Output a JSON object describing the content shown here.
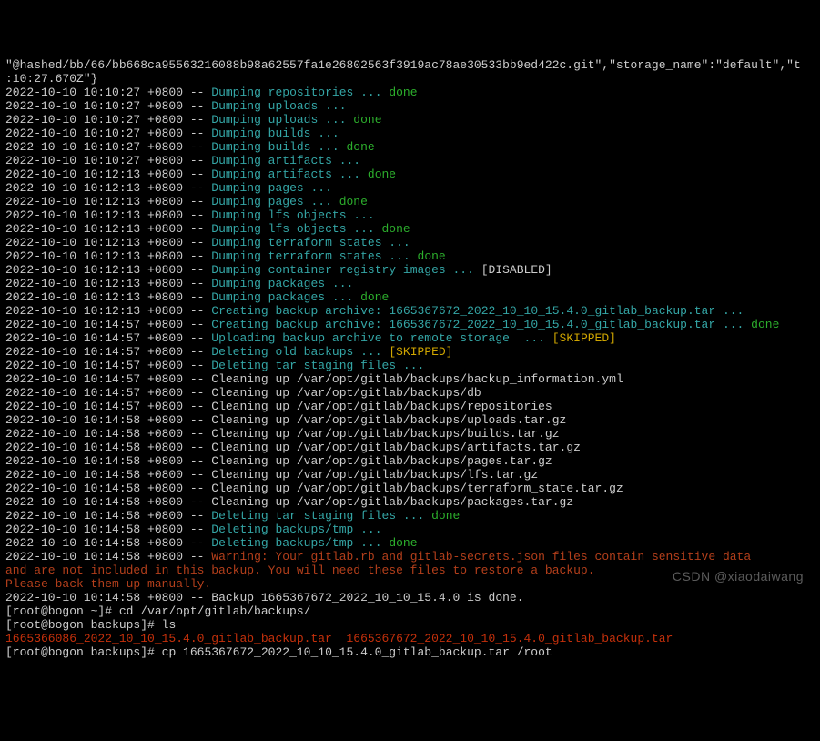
{
  "header": "\"@hashed/bb/66/bb668ca95563216088b98a62557fa1e26802563f3919ac78ae30533bb9ed422c.git\",\"storage_name\":\"default\",\"t",
  "header2": ":10:27.670Z\"}",
  "lines": [
    {
      "ts": "2022-10-10 10:10:27 +0800",
      "sep": " -- ",
      "parts": [
        {
          "cls": "teal",
          "t": "Dumping repositories ... "
        },
        {
          "cls": "green",
          "t": "done"
        }
      ]
    },
    {
      "ts": "2022-10-10 10:10:27 +0800",
      "sep": " -- ",
      "parts": [
        {
          "cls": "teal",
          "t": "Dumping uploads ... "
        }
      ]
    },
    {
      "ts": "2022-10-10 10:10:27 +0800",
      "sep": " -- ",
      "parts": [
        {
          "cls": "teal",
          "t": "Dumping uploads ... "
        },
        {
          "cls": "green",
          "t": "done"
        }
      ]
    },
    {
      "ts": "2022-10-10 10:10:27 +0800",
      "sep": " -- ",
      "parts": [
        {
          "cls": "teal",
          "t": "Dumping builds ... "
        }
      ]
    },
    {
      "ts": "2022-10-10 10:10:27 +0800",
      "sep": " -- ",
      "parts": [
        {
          "cls": "teal",
          "t": "Dumping builds ... "
        },
        {
          "cls": "green",
          "t": "done"
        }
      ]
    },
    {
      "ts": "2022-10-10 10:10:27 +0800",
      "sep": " -- ",
      "parts": [
        {
          "cls": "teal",
          "t": "Dumping artifacts ... "
        }
      ]
    },
    {
      "ts": "2022-10-10 10:12:13 +0800",
      "sep": " -- ",
      "parts": [
        {
          "cls": "teal",
          "t": "Dumping artifacts ... "
        },
        {
          "cls": "green",
          "t": "done"
        }
      ]
    },
    {
      "ts": "2022-10-10 10:12:13 +0800",
      "sep": " -- ",
      "parts": [
        {
          "cls": "teal",
          "t": "Dumping pages ... "
        }
      ]
    },
    {
      "ts": "2022-10-10 10:12:13 +0800",
      "sep": " -- ",
      "parts": [
        {
          "cls": "teal",
          "t": "Dumping pages ... "
        },
        {
          "cls": "green",
          "t": "done"
        }
      ]
    },
    {
      "ts": "2022-10-10 10:12:13 +0800",
      "sep": " -- ",
      "parts": [
        {
          "cls": "teal",
          "t": "Dumping lfs objects ... "
        }
      ]
    },
    {
      "ts": "2022-10-10 10:12:13 +0800",
      "sep": " -- ",
      "parts": [
        {
          "cls": "teal",
          "t": "Dumping lfs objects ... "
        },
        {
          "cls": "green",
          "t": "done"
        }
      ]
    },
    {
      "ts": "2022-10-10 10:12:13 +0800",
      "sep": " -- ",
      "parts": [
        {
          "cls": "teal",
          "t": "Dumping terraform states ... "
        }
      ]
    },
    {
      "ts": "2022-10-10 10:12:13 +0800",
      "sep": " -- ",
      "parts": [
        {
          "cls": "teal",
          "t": "Dumping terraform states ... "
        },
        {
          "cls": "green",
          "t": "done"
        }
      ]
    },
    {
      "ts": "2022-10-10 10:12:13 +0800",
      "sep": " -- ",
      "parts": [
        {
          "cls": "teal",
          "t": "Dumping container registry images ... "
        },
        {
          "cls": "gray",
          "t": "[DISABLED]"
        }
      ]
    },
    {
      "ts": "2022-10-10 10:12:13 +0800",
      "sep": " -- ",
      "parts": [
        {
          "cls": "teal",
          "t": "Dumping packages ... "
        }
      ]
    },
    {
      "ts": "2022-10-10 10:12:13 +0800",
      "sep": " -- ",
      "parts": [
        {
          "cls": "teal",
          "t": "Dumping packages ... "
        },
        {
          "cls": "green",
          "t": "done"
        }
      ]
    },
    {
      "ts": "2022-10-10 10:12:13 +0800",
      "sep": " -- ",
      "parts": [
        {
          "cls": "teal",
          "t": "Creating backup archive: 1665367672_2022_10_10_15.4.0_gitlab_backup.tar ... "
        }
      ]
    },
    {
      "ts": "2022-10-10 10:14:57 +0800",
      "sep": " -- ",
      "parts": [
        {
          "cls": "teal",
          "t": "Creating backup archive: 1665367672_2022_10_10_15.4.0_gitlab_backup.tar ... "
        },
        {
          "cls": "green",
          "t": "done"
        }
      ]
    },
    {
      "ts": "2022-10-10 10:14:57 +0800",
      "sep": " -- ",
      "parts": [
        {
          "cls": "teal",
          "t": "Uploading backup archive to remote storage  ... "
        },
        {
          "cls": "yellow",
          "t": "[SKIPPED]"
        }
      ]
    },
    {
      "ts": "2022-10-10 10:14:57 +0800",
      "sep": " -- ",
      "parts": [
        {
          "cls": "teal",
          "t": "Deleting old backups ... "
        },
        {
          "cls": "yellow",
          "t": "[SKIPPED]"
        }
      ]
    },
    {
      "ts": "2022-10-10 10:14:57 +0800",
      "sep": " -- ",
      "parts": [
        {
          "cls": "teal",
          "t": "Deleting tar staging files ... "
        }
      ]
    },
    {
      "ts": "2022-10-10 10:14:57 +0800",
      "sep": " -- ",
      "parts": [
        {
          "cls": "gray",
          "t": "Cleaning up /var/opt/gitlab/backups/backup_information.yml"
        }
      ]
    },
    {
      "ts": "2022-10-10 10:14:57 +0800",
      "sep": " -- ",
      "parts": [
        {
          "cls": "gray",
          "t": "Cleaning up /var/opt/gitlab/backups/db"
        }
      ]
    },
    {
      "ts": "2022-10-10 10:14:57 +0800",
      "sep": " -- ",
      "parts": [
        {
          "cls": "gray",
          "t": "Cleaning up /var/opt/gitlab/backups/repositories"
        }
      ]
    },
    {
      "ts": "2022-10-10 10:14:58 +0800",
      "sep": " -- ",
      "parts": [
        {
          "cls": "gray",
          "t": "Cleaning up /var/opt/gitlab/backups/uploads.tar.gz"
        }
      ]
    },
    {
      "ts": "2022-10-10 10:14:58 +0800",
      "sep": " -- ",
      "parts": [
        {
          "cls": "gray",
          "t": "Cleaning up /var/opt/gitlab/backups/builds.tar.gz"
        }
      ]
    },
    {
      "ts": "2022-10-10 10:14:58 +0800",
      "sep": " -- ",
      "parts": [
        {
          "cls": "gray",
          "t": "Cleaning up /var/opt/gitlab/backups/artifacts.tar.gz"
        }
      ]
    },
    {
      "ts": "2022-10-10 10:14:58 +0800",
      "sep": " -- ",
      "parts": [
        {
          "cls": "gray",
          "t": "Cleaning up /var/opt/gitlab/backups/pages.tar.gz"
        }
      ]
    },
    {
      "ts": "2022-10-10 10:14:58 +0800",
      "sep": " -- ",
      "parts": [
        {
          "cls": "gray",
          "t": "Cleaning up /var/opt/gitlab/backups/lfs.tar.gz"
        }
      ]
    },
    {
      "ts": "2022-10-10 10:14:58 +0800",
      "sep": " -- ",
      "parts": [
        {
          "cls": "gray",
          "t": "Cleaning up /var/opt/gitlab/backups/terraform_state.tar.gz"
        }
      ]
    },
    {
      "ts": "2022-10-10 10:14:58 +0800",
      "sep": " -- ",
      "parts": [
        {
          "cls": "gray",
          "t": "Cleaning up /var/opt/gitlab/backups/packages.tar.gz"
        }
      ]
    },
    {
      "ts": "2022-10-10 10:14:58 +0800",
      "sep": " -- ",
      "parts": [
        {
          "cls": "teal",
          "t": "Deleting tar staging files ... "
        },
        {
          "cls": "green",
          "t": "done"
        }
      ]
    },
    {
      "ts": "2022-10-10 10:14:58 +0800",
      "sep": " -- ",
      "parts": [
        {
          "cls": "teal",
          "t": "Deleting backups/tmp ... "
        }
      ]
    },
    {
      "ts": "2022-10-10 10:14:58 +0800",
      "sep": " -- ",
      "parts": [
        {
          "cls": "teal",
          "t": "Deleting backups/tmp ... "
        },
        {
          "cls": "green",
          "t": "done"
        }
      ]
    },
    {
      "ts": "2022-10-10 10:14:58 +0800",
      "sep": " -- ",
      "parts": [
        {
          "cls": "red",
          "t": "Warning: Your gitlab.rb and gitlab-secrets.json files contain sensitive data"
        }
      ]
    }
  ],
  "warn2": "and are not included in this backup. You will need these files to restore a backup.",
  "warn3": "Please back them up manually.",
  "doneLine": {
    "ts": "2022-10-10 10:14:58 +0800",
    "sep": " -- ",
    "text": "Backup 1665367672_2022_10_10_15.4.0 is done."
  },
  "prompt1": {
    "user": "[root@bogon ~]# ",
    "cmd": "cd /var/opt/gitlab/backups/"
  },
  "prompt2": {
    "user": "[root@bogon backups]# ",
    "cmd": "ls"
  },
  "lsOutput": "1665366086_2022_10_10_15.4.0_gitlab_backup.tar  1665367672_2022_10_10_15.4.0_gitlab_backup.tar",
  "prompt3": {
    "user": "[root@bogon backups]# ",
    "cmd": "cp 1665367672_2022_10_10_15.4.0_gitlab_backup.tar /root"
  },
  "watermark": "CSDN @xiaodaiwang"
}
